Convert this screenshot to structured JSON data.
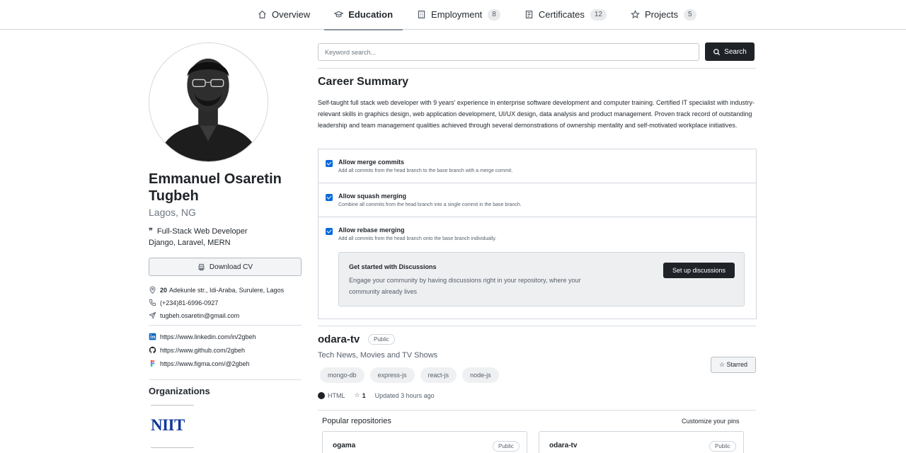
{
  "nav": {
    "tabs": [
      {
        "label": "Overview",
        "icon": "home-icon"
      },
      {
        "label": "Education",
        "icon": "graduation-cap-icon",
        "active": true
      },
      {
        "label": "Employment",
        "icon": "building-icon",
        "count": "8"
      },
      {
        "label": "Certificates",
        "icon": "certificate-icon",
        "count": "12"
      },
      {
        "label": "Projects",
        "icon": "star-icon",
        "count": "5"
      }
    ]
  },
  "profile": {
    "name": "Emmanuel Osaretin Tugbeh",
    "location": "Lagos, NG",
    "bio_line1": "Full-Stack Web Developer",
    "bio_line2": "Django, Laravel, MERN",
    "download_label": "Download CV",
    "address_number": "20",
    "address_rest": "Adekunle str., Idi-Araba, Surulere, Lagos",
    "phone": "(+234)81-6996-0927",
    "email": "tugbeh.osaretin@gmail.com",
    "linkedin": "https://www.linkedin.com/in/2gbeh",
    "github": "https://www.github.com/2gbeh",
    "figma": "https://www.figma.com/@2gbeh",
    "organizations_title": "Organizations",
    "org_logo_text": "NIIT"
  },
  "search": {
    "placeholder": "Keyword search...",
    "button_label": "Search"
  },
  "career": {
    "title": "Career Summary",
    "summary": "Self-taught full stack web developer with 9 years' experience in enterprise software development and computer training. Certified IT specialist with industry-relevant skills in graphics design, web application development, UI/UX design, data analysis and product management. Proven track record of outstanding leadership and team management qualities achieved through several demonstrations of ownership mentality and self-motivated workplace initiatives."
  },
  "settings": [
    {
      "title": "Allow merge commits",
      "desc": "Add all commits from the head branch to the base branch with a merge commit."
    },
    {
      "title": "Allow squash merging",
      "desc": "Combine all commits from the head branch into a single commit in the base branch."
    },
    {
      "title": "Allow rebase merging",
      "desc": "Add all commits from the head branch onto the base branch individually."
    }
  ],
  "discussions": {
    "title": "Get started with Discussions",
    "text": "Engage your community by having discussions right in your repository, where your community already lives",
    "button": "Set up discussions"
  },
  "repo": {
    "name": "odara-tv",
    "visibility": "Public",
    "description": "Tech News, Movies and TV Shows",
    "star_button": "☆ Starred",
    "topics": [
      "mongo-db",
      "express-js",
      "react-js",
      "node-js"
    ],
    "language": "HTML",
    "stars": "1",
    "updated": "Updated 3 hours ago"
  },
  "popular": {
    "title": "Popular repositories",
    "customize": "Customize your pins",
    "cards": [
      {
        "name": "ogama",
        "visibility": "Public"
      },
      {
        "name": "odara-tv",
        "visibility": "Public"
      }
    ]
  }
}
